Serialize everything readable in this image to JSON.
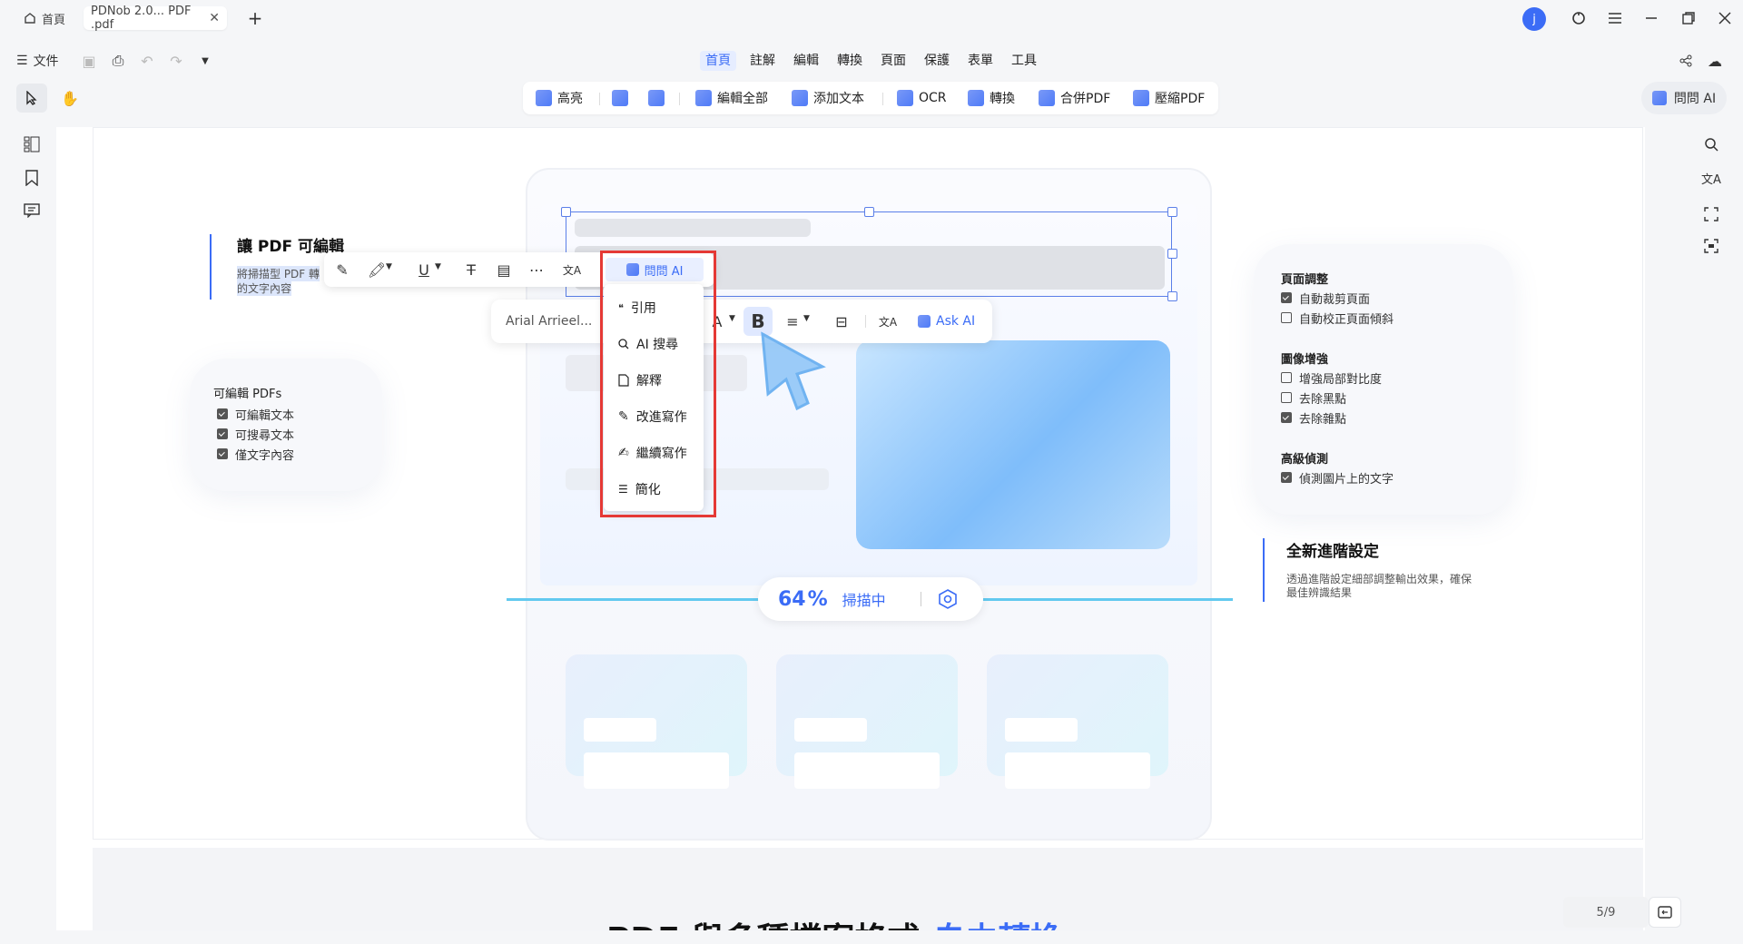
{
  "tabs": [
    {
      "label": "首頁"
    },
    {
      "label": "PDNob 2.0... PDF .pdf"
    }
  ],
  "titlebar": {
    "avatar": "j"
  },
  "toolbar_left": {
    "file_label": "文件"
  },
  "menu": [
    "首頁",
    "註解",
    "編輯",
    "轉換",
    "頁面",
    "保護",
    "表單",
    "工具"
  ],
  "tools": {
    "highlight": "高亮",
    "edit_all": "編輯全部",
    "add_text": "添加文本",
    "ocr": "OCR",
    "convert": "轉換",
    "merge": "合併PDF",
    "compress": "壓縮PDF"
  },
  "ask_ai_top": "問問 AI",
  "doc": {
    "left_heading": "讓 PDF 可編輯",
    "left_sub1": "將掃描型 PDF 轉",
    "left_sub2": "的文字內容",
    "editable_title": "可編輯 PDFs",
    "editable_items": [
      "可編輯文本",
      "可搜尋文本",
      "僅文字內容"
    ],
    "right_card": {
      "s1": "頁面調整",
      "s1_items": [
        {
          "t": "自動裁剪頁面",
          "on": true
        },
        {
          "t": "自動校正頁面傾斜",
          "on": false
        }
      ],
      "s2": "圖像增強",
      "s2_items": [
        {
          "t": "增強局部對比度",
          "on": false
        },
        {
          "t": "去除黑點",
          "on": false
        },
        {
          "t": "去除雜點",
          "on": true
        }
      ],
      "s3": "高級偵測",
      "s3_items": [
        {
          "t": "偵測圖片上的文字",
          "on": true
        }
      ]
    },
    "adv_title": "全新進階設定",
    "adv_desc1": "透過進階設定細部調整輸出效果，確保",
    "adv_desc2": "最佳辨識結果",
    "progress_value": "64",
    "progress_unit": "%",
    "progress_label": "掃描中",
    "bottom_heading": "PDF 與多種檔案格式",
    "bottom_heading_accent": "自由轉換"
  },
  "popup": {
    "ask_ai": "問問 AI",
    "font": "Arial Arrieel...",
    "ask_ai_en": "Ask AI",
    "menu": [
      "引用",
      "AI 搜尋",
      "解釋",
      "改進寫作",
      "繼續寫作",
      "簡化"
    ]
  },
  "page_indicator": "5/9",
  "colors": {
    "accent": "#3b6cf6",
    "highlight_box": "#e53935"
  }
}
